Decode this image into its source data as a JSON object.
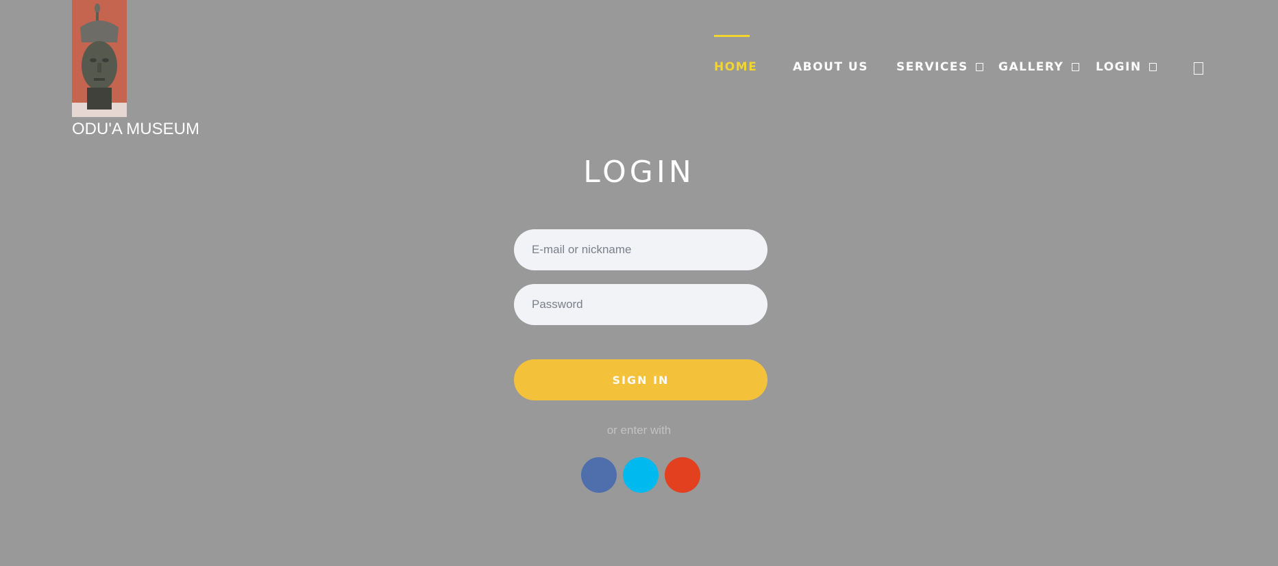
{
  "brand": {
    "name": "ODU'A MUSEUM",
    "image_icon": "bronze-head-sculpture"
  },
  "nav": {
    "items": [
      {
        "label": "HOME",
        "active": true
      },
      {
        "label": "ABOUT US",
        "active": false
      },
      {
        "label": "SERVICES",
        "has_dropdown": true
      },
      {
        "label": "GALLERY",
        "has_dropdown": true
      },
      {
        "label": "LOGIN",
        "has_dropdown": true
      }
    ],
    "cart_icon": "cart-icon"
  },
  "login": {
    "title": "LOGIN",
    "email_placeholder": "E-mail or nickname",
    "password_placeholder": "Password",
    "signin_label": "SIGN IN",
    "or_text": "or enter with",
    "social": [
      {
        "icon": "facebook-icon",
        "color": "#4e6fab"
      },
      {
        "icon": "twitter-icon",
        "color": "#00b9ef"
      },
      {
        "icon": "google-plus-icon",
        "color": "#e2401f"
      }
    ]
  },
  "colors": {
    "background": "#999999",
    "accent_yellow": "#f2d62e",
    "button_yellow": "#f4c23a",
    "input_bg": "#f2f3f7"
  }
}
